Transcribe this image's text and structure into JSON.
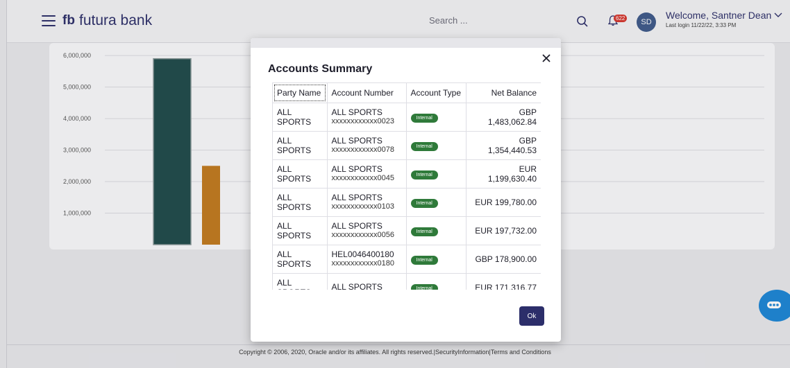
{
  "header": {
    "brand": "futura bank",
    "logo_mark": "fb",
    "search_placeholder": "Search ...",
    "notification_count": "622",
    "avatar_initials": "SD",
    "welcome_text": "Welcome, Santner Dean",
    "last_login": "Last login 11/22/22, 3:33 PM"
  },
  "chart_data": {
    "type": "bar",
    "title": "",
    "y_ticks": [
      "6,000,000",
      "5,000,000",
      "4,000,000",
      "3,000,000",
      "2,000,000",
      "1,000,000"
    ],
    "ylim": [
      0,
      6000000
    ],
    "series": [
      {
        "values": [
          5900000
        ],
        "color": "#1f4a4a"
      },
      {
        "values": [
          2500000
        ],
        "color": "#c27a1e"
      }
    ]
  },
  "modal": {
    "title": "Accounts Summary",
    "columns": [
      "Party Name",
      "Account Number",
      "Account Type",
      "Net Balance"
    ],
    "rows": [
      {
        "party": "ALL SPORTS",
        "account_name": "ALL SPORTS",
        "account_number": "xxxxxxxxxxxx0023",
        "type": "Internal",
        "balance": "GBP 1,483,062.84"
      },
      {
        "party": "ALL SPORTS",
        "account_name": "ALL SPORTS",
        "account_number": "xxxxxxxxxxxx0078",
        "type": "Internal",
        "balance": "GBP 1,354,440.53"
      },
      {
        "party": "ALL SPORTS",
        "account_name": "ALL SPORTS",
        "account_number": "xxxxxxxxxxxx0045",
        "type": "Internal",
        "balance": "EUR 1,199,630.40"
      },
      {
        "party": "ALL SPORTS",
        "account_name": "ALL SPORTS",
        "account_number": "xxxxxxxxxxxx0103",
        "type": "Internal",
        "balance": "EUR 199,780.00"
      },
      {
        "party": "ALL SPORTS",
        "account_name": "ALL SPORTS",
        "account_number": "xxxxxxxxxxxx0056",
        "type": "Internal",
        "balance": "EUR 197,732.00"
      },
      {
        "party": "ALL SPORTS",
        "account_name": "HEL0046400180",
        "account_number": "xxxxxxxxxxxx0180",
        "type": "Internal",
        "balance": "GBP 178,900.00"
      },
      {
        "party": "ALL SPORTS",
        "account_name": "ALL SPORTS",
        "account_number": "",
        "type": "Internal",
        "balance": "EUR 171,316.77"
      }
    ],
    "ok_label": "Ok"
  },
  "footer": {
    "copyright": "Copyright © 2006, 2020, Oracle and/or its affiliates. All rights reserved.|SecurityInformation|Terms and Conditions"
  },
  "colors": {
    "brand": "#2c2e6a",
    "internal_badge": "#2f7a3a",
    "chat": "#1c86d6"
  },
  "icons": [
    "menu-icon",
    "search-icon",
    "bell-icon",
    "chevron-down-icon",
    "close-icon",
    "chat-icon"
  ]
}
